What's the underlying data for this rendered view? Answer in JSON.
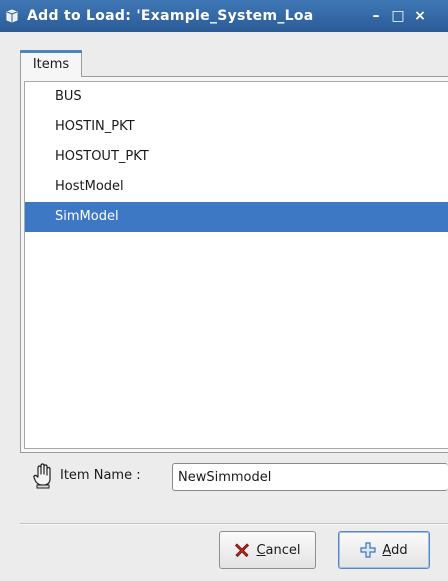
{
  "window": {
    "title": "Add to Load: 'Example_System_Loa",
    "minimize_glyph": "–",
    "maximize_glyph": "□",
    "close_glyph": "×"
  },
  "tabs": [
    {
      "label": "Items",
      "active": true
    }
  ],
  "items_list": {
    "items": [
      {
        "label": "BUS",
        "selected": false
      },
      {
        "label": "HOSTIN_PKT",
        "selected": false
      },
      {
        "label": "HOSTOUT_PKT",
        "selected": false
      },
      {
        "label": "HostModel",
        "selected": false
      },
      {
        "label": "SimModel",
        "selected": true
      }
    ]
  },
  "item_name": {
    "label": "Item Name :",
    "value": "NewSimmodel"
  },
  "buttons": {
    "cancel": {
      "mnemonic": "C",
      "rest": "ancel",
      "icon": "x-icon"
    },
    "add": {
      "mnemonic": "A",
      "rest": "dd",
      "icon": "plus-icon"
    }
  },
  "colors": {
    "titlebar": "#2f66a6",
    "selection": "#3c78c4",
    "cancel_icon": "#c0281c",
    "add_icon": "#3b74c7"
  }
}
